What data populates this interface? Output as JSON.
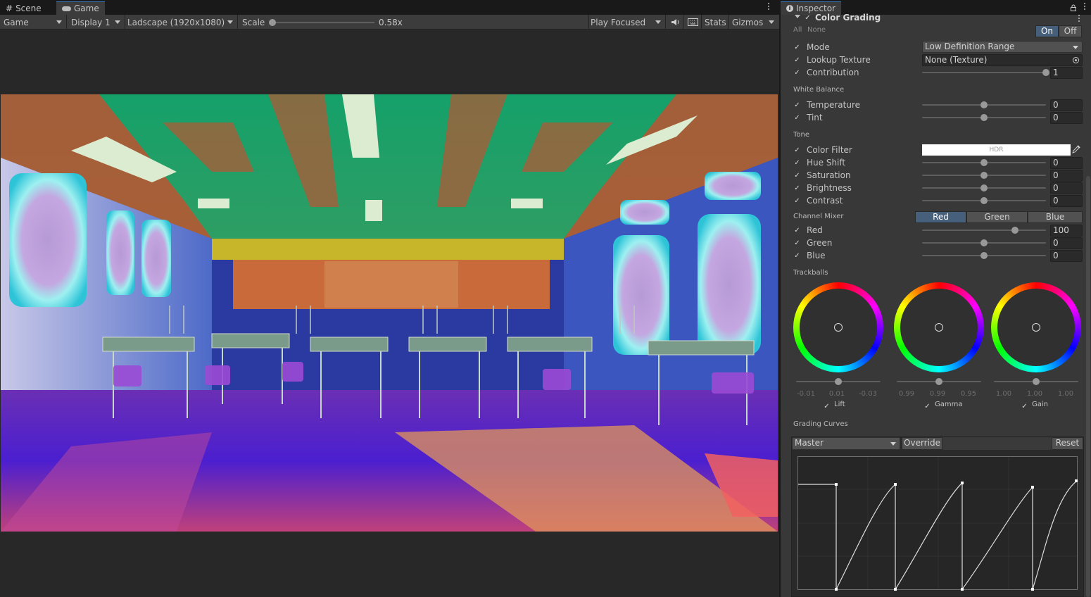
{
  "game_panel": {
    "tabs": [
      {
        "label": "Scene",
        "icon": "hash-grid-icon"
      },
      {
        "label": "Game",
        "icon": "gamepad-icon"
      }
    ],
    "toolbar": {
      "display_mode": "Game",
      "display": "Display 1",
      "resolution": "Ladscape (1920x1080)",
      "scale_label": "Scale",
      "scale_value": "0.58x",
      "scale_fraction": 0.0,
      "play_mode": "Play Focused",
      "audio_icon": "speaker-icon",
      "stats_icon": "keyboard-icon",
      "stats_label": "Stats",
      "gizmos_label": "Gizmos"
    }
  },
  "inspector": {
    "tab_label": "Inspector",
    "tab_icon": "info-icon",
    "component_title": "Color Grading",
    "all_label": "All",
    "none_label": "None",
    "on_label": "On",
    "off_label": "Off",
    "mode": {
      "label": "Mode",
      "value": "Low Definition Range"
    },
    "lookup_texture": {
      "label": "Lookup Texture",
      "value": "None (Texture)"
    },
    "contribution": {
      "label": "Contribution",
      "value": "1",
      "fraction": 1.0
    },
    "white_balance": {
      "header": "White Balance",
      "temperature": {
        "label": "Temperature",
        "value": "0",
        "fraction": 0.5
      },
      "tint": {
        "label": "Tint",
        "value": "0",
        "fraction": 0.5
      }
    },
    "tone": {
      "header": "Tone",
      "color_filter": {
        "label": "Color Filter",
        "value": "HDR",
        "color": "#ffffff"
      },
      "hue_shift": {
        "label": "Hue Shift",
        "value": "0",
        "fraction": 0.5
      },
      "saturation": {
        "label": "Saturation",
        "value": "0",
        "fraction": 0.5
      },
      "brightness": {
        "label": "Brightness",
        "value": "0",
        "fraction": 0.5
      },
      "contrast": {
        "label": "Contrast",
        "value": "0",
        "fraction": 0.5
      }
    },
    "channel_mixer": {
      "header": "Channel Mixer",
      "tabs": [
        "Red",
        "Green",
        "Blue"
      ],
      "selected_tab": "Red",
      "red": {
        "label": "Red",
        "value": "100",
        "fraction": 0.75
      },
      "green": {
        "label": "Green",
        "value": "0",
        "fraction": 0.5
      },
      "blue": {
        "label": "Blue",
        "value": "0",
        "fraction": 0.5
      }
    },
    "trackballs": {
      "header": "Trackballs",
      "items": [
        {
          "label": "Lift",
          "values": [
            "-0.01",
            "0.01",
            "-0.03"
          ]
        },
        {
          "label": "Gamma",
          "values": [
            "0.99",
            "0.99",
            "0.95"
          ]
        },
        {
          "label": "Gain",
          "values": [
            "1.00",
            "1.00",
            "1.00"
          ]
        }
      ]
    },
    "grading_curves": {
      "header": "Grading Curves",
      "channel": "Master",
      "override_label": "Override",
      "reset_label": "Reset"
    }
  }
}
